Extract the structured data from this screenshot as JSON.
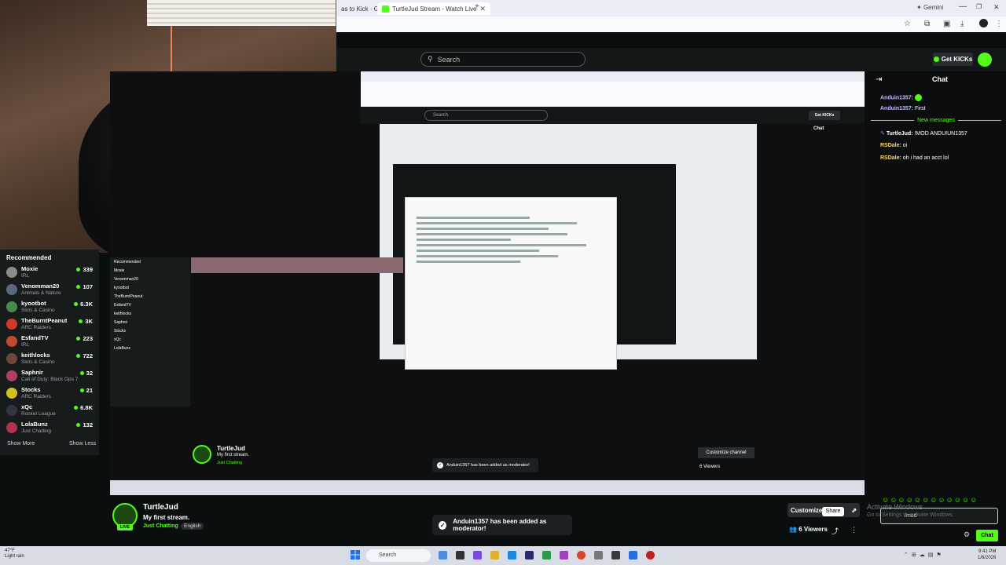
{
  "browser": {
    "tab_partial": "as to Kick · G",
    "tab_active": "TurtleJud Stream - Watch Live",
    "new_tab": "+",
    "gemini": "Gemini",
    "window_minimize": "—",
    "window_maximize": "❐",
    "window_close": "✕"
  },
  "kick": {
    "search_placeholder": "Search",
    "get_kicks": "Get KICKs"
  },
  "sidebar": {
    "heading": "Recommended",
    "items": [
      {
        "name": "Moxie",
        "category": "IRL",
        "viewers": "339",
        "color": "#8a8a8a"
      },
      {
        "name": "Venomman20",
        "category": "Animals & Nature",
        "viewers": "107",
        "color": "#5a6a7a"
      },
      {
        "name": "kyootbot",
        "category": "Slots & Casino",
        "viewers": "6.3K",
        "color": "#4a8a4a"
      },
      {
        "name": "TheBurntPeanut",
        "category": "ARC Raiders",
        "viewers": "3K",
        "color": "#d03a2a"
      },
      {
        "name": "EsfandTV",
        "category": "IRL",
        "viewers": "223",
        "color": "#c04a30"
      },
      {
        "name": "keithlocks",
        "category": "Slots & Casino",
        "viewers": "722",
        "color": "#6a4a3a"
      },
      {
        "name": "Saphnir",
        "category": "Call of Duty: Black Ops 7",
        "viewers": "32",
        "color": "#b04060"
      },
      {
        "name": "Stocks",
        "category": "ARC Raiders",
        "viewers": "21",
        "color": "#d0c020"
      },
      {
        "name": "xQc",
        "category": "Rocket League",
        "viewers": "6.8K",
        "color": "#303540"
      },
      {
        "name": "LolaBunz",
        "category": "Just Chatting",
        "viewers": "132",
        "color": "#b03050"
      }
    ],
    "show_more": "Show More",
    "show_less": "Show Less"
  },
  "nested": {
    "search": "Search",
    "get_kicks": "Get KICKs",
    "streamer": "TurtleJud",
    "title": "My first stream.",
    "category": "Just Chatting",
    "language": "English",
    "toast": "Anduin1357 has been added as moderator!",
    "customize": "Customize channel",
    "viewers": "6 Viewers",
    "chat_title": "Chat",
    "recommended": "Recommended"
  },
  "chat": {
    "title": "Chat",
    "messages": [
      {
        "user": "Anduin1357:",
        "text": ""
      },
      {
        "user": "Anduin1357:",
        "text": "First"
      },
      {
        "user": "TurtleJud:",
        "text": "!MOD ANDUIUN1357"
      },
      {
        "user": "RSDale:",
        "text": "oi"
      },
      {
        "user": "RSDale:",
        "text": "oh i had an acct lol"
      }
    ],
    "new_messages": "New messages",
    "input_value": "/mod",
    "send": "Chat",
    "watermark": "Activate Windows",
    "watermark_sub": "Go to Settings to activate Windows."
  },
  "stream": {
    "streamer": "TurtleJud",
    "title": "My first stream.",
    "category": "Just Chatting",
    "language": "English",
    "live": "LIVE",
    "toast": "Anduin1357 has been added as moderator!",
    "customize": "Customize",
    "share_tooltip": "Share",
    "viewers": "6 Viewers"
  },
  "taskbar": {
    "weather_temp": "47°F",
    "weather_desc": "Light rain",
    "search": "Search",
    "time": "9:41 PM",
    "date": "1/6/2026"
  },
  "colors": {
    "accent": "#53fc18",
    "background": "#0b0e0f"
  }
}
